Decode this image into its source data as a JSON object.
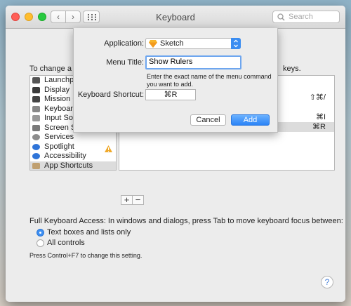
{
  "window": {
    "title": "Keyboard"
  },
  "search": {
    "placeholder": "Search"
  },
  "background": {
    "intro_left": "To change a sh",
    "intro_right": "keys.",
    "categories": [
      {
        "label": "Launchpa",
        "icon": "launchpad-icon",
        "color": "#555555"
      },
      {
        "label": "Display",
        "icon": "display-icon",
        "color": "#3b3b3b"
      },
      {
        "label": "Mission C",
        "icon": "mission-control-icon",
        "color": "#444444"
      },
      {
        "label": "Keyboard",
        "icon": "keyboard-icon",
        "color": "#888888"
      },
      {
        "label": "Input Sou",
        "icon": "input-sources-icon",
        "color": "#999999"
      },
      {
        "label": "Screen Shots",
        "icon": "screenshot-icon",
        "color": "#7a7a7a"
      },
      {
        "label": "Services",
        "icon": "gear-icon",
        "color": "#8c8c8c"
      },
      {
        "label": "Spotlight",
        "icon": "spotlight-icon",
        "color": "#2f74d8"
      },
      {
        "label": "Accessibility",
        "icon": "accessibility-icon",
        "color": "#2f74d8"
      },
      {
        "label": "App Shortcuts",
        "icon": "app-shortcuts-icon",
        "color": "#c0a070"
      }
    ],
    "shortcut_keys": [
      "⇧⌘/",
      "⌘I",
      "⌘R"
    ],
    "full_keyboard_access": "Full Keyboard Access: In windows and dialogs, press Tab to move keyboard focus between:",
    "radio_text_boxes": "Text boxes and lists only",
    "radio_all_controls": "All controls",
    "note": "Press Control+F7 to change this setting.",
    "help": "?",
    "plus": "+",
    "minus": "−"
  },
  "sheet": {
    "application_label": "Application:",
    "application_value": "Sketch",
    "menu_title_label": "Menu Title:",
    "menu_title_value": "Show Rulers",
    "hint": "Enter the exact name of the menu command you want to add.",
    "keyboard_shortcut_label": "Keyboard Shortcut:",
    "keyboard_shortcut_value": "⌘R",
    "cancel": "Cancel",
    "add": "Add"
  },
  "colors": {
    "accent": "#2b83f6",
    "close": "#ff5f57",
    "minimize": "#ffbd2e",
    "zoom": "#28c940"
  }
}
